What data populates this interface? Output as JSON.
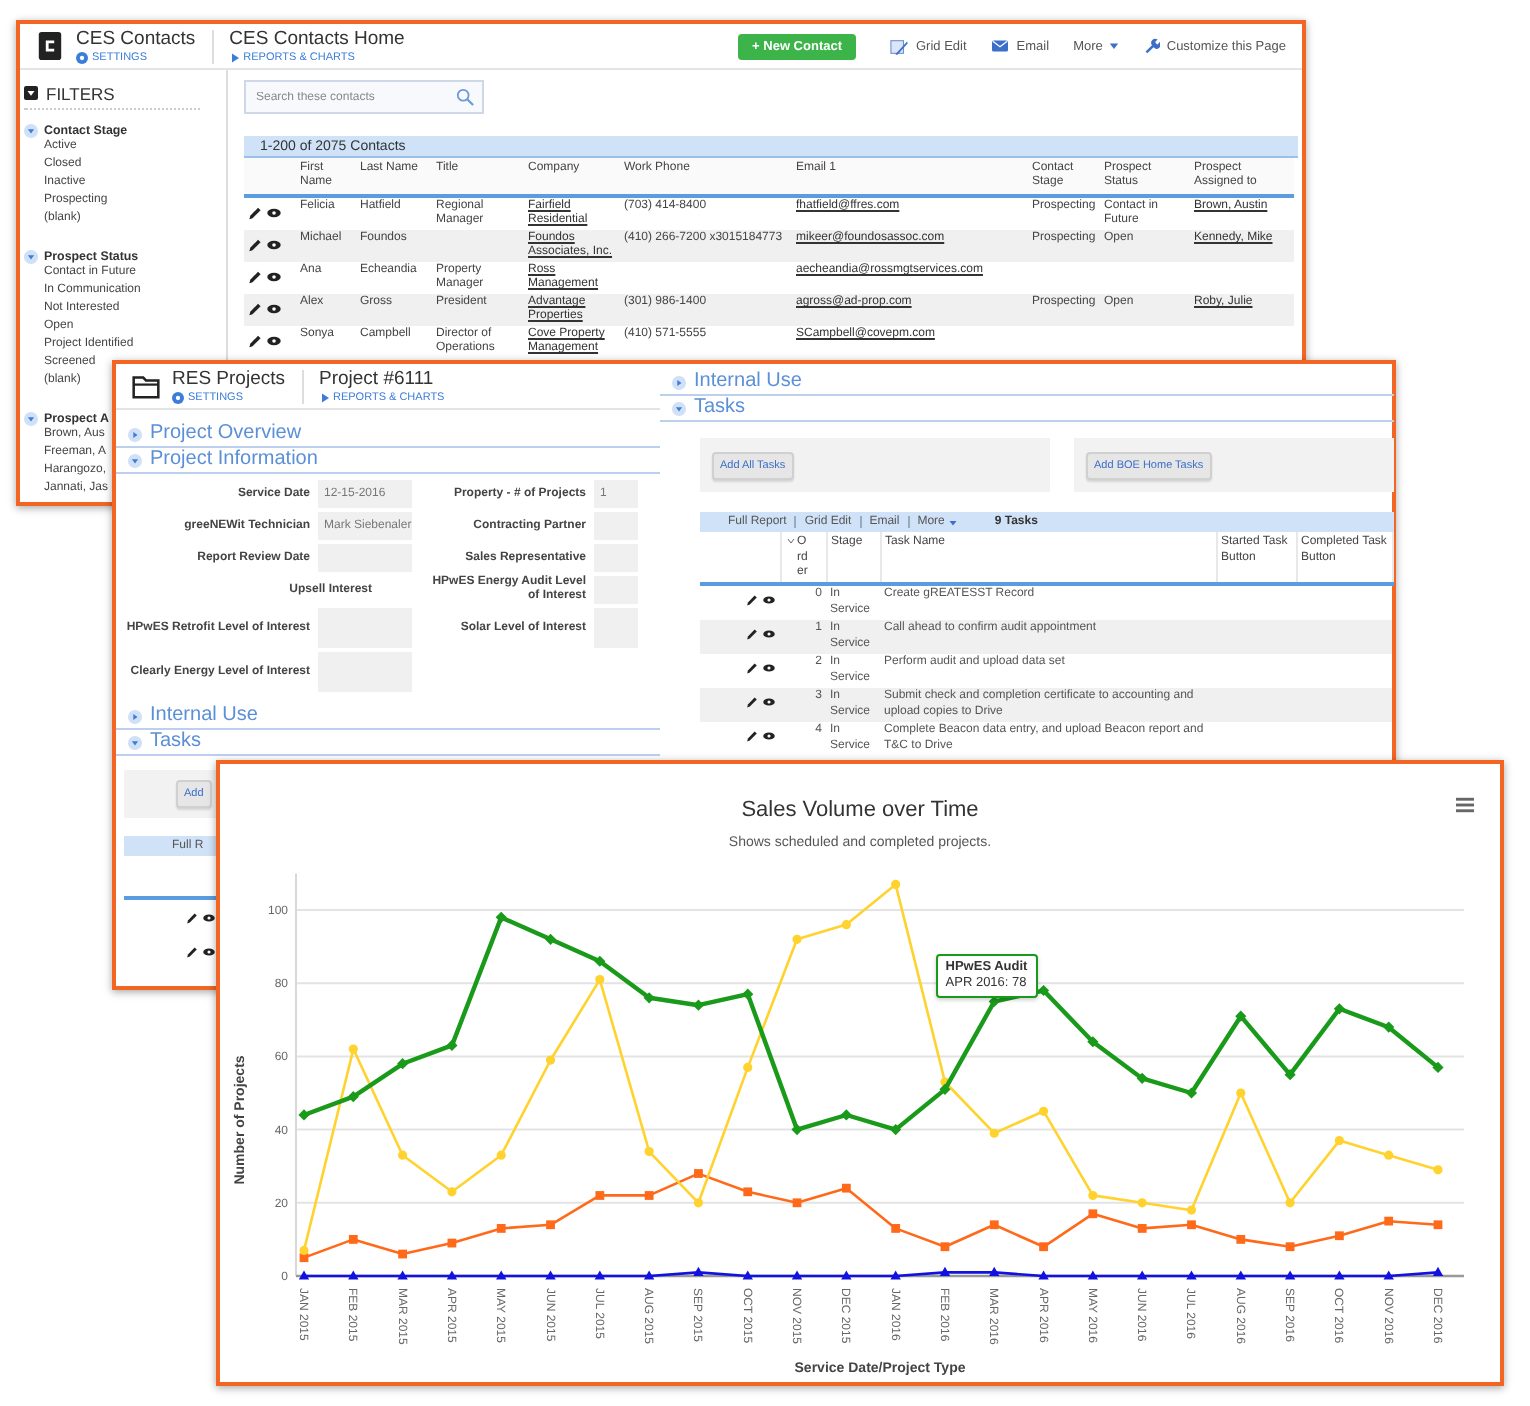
{
  "contacts_window": {
    "app_title": "CES Contacts",
    "settings_link": "SETTINGS",
    "page_title": "CES Contacts Home",
    "reports_link": "REPORTS & CHARTS",
    "new_button": "+ New Contact",
    "toolbar": [
      {
        "kind": "grid",
        "label": "Grid Edit"
      },
      {
        "kind": "email",
        "label": "Email"
      },
      {
        "kind": "more",
        "label": "More"
      },
      {
        "kind": "customize",
        "label": "Customize this Page"
      }
    ],
    "filters": {
      "title": "FILTERS",
      "groups": [
        {
          "title": "Contact Stage",
          "expanded": true,
          "items": [
            "Active",
            "Closed",
            "Inactive",
            "Prospecting",
            "(blank)"
          ]
        },
        {
          "title": "Prospect Status",
          "expanded": true,
          "items": [
            "Contact in Future",
            "In Communication",
            "Not Interested",
            "Open",
            "Project Identified",
            "Screened",
            "(blank)"
          ]
        },
        {
          "title": "Prospect A",
          "expanded": true,
          "items": [
            "Brown, Aus",
            "Freeman, A",
            "Harangozo,",
            "Jannati, Jas"
          ]
        }
      ]
    },
    "search": {
      "placeholder": "Search these contacts"
    },
    "table": {
      "count": "1-200 of 2075 Contacts",
      "columns": [
        {
          "label": "First Name",
          "kind": "text"
        },
        {
          "label": "Last Name",
          "kind": "text"
        },
        {
          "label": "Title",
          "kind": "text"
        },
        {
          "label": "Company",
          "kind": "link"
        },
        {
          "label": "Work Phone",
          "kind": "text"
        },
        {
          "label": "Email 1",
          "kind": "link"
        },
        {
          "label": "Contact Stage",
          "kind": "text"
        },
        {
          "label": "Prospect Status",
          "kind": "text"
        },
        {
          "label": "Prospect Assigned to",
          "kind": "link"
        }
      ],
      "rows": [
        [
          "Felicia",
          "Hatfield",
          "Regional Manager",
          "Fairfield Residential",
          "(703) 414-8400",
          "fhatfield@ffres.com",
          "Prospecting",
          "Contact in Future",
          "Brown, Austin"
        ],
        [
          "Michael",
          "Foundos",
          null,
          "Foundos Associates, Inc.",
          "(410) 266-7200 x3015184773",
          "mikeer@foundosassoc.com",
          "Prospecting",
          "Open",
          "Kennedy, Mike"
        ],
        [
          "Ana",
          "Echeandia",
          "Property Manager",
          "Ross Management",
          null,
          "aecheandia@rossmgtservices.com",
          null,
          null,
          null
        ],
        [
          "Alex",
          "Gross",
          "President",
          "Advantage Properties",
          "(301) 986-1400",
          "agross@ad-prop.com",
          "Prospecting",
          "Open",
          "Roby, Julie"
        ],
        [
          "Sonya",
          "Campbell",
          "Director of Operations",
          "Cove Property Management",
          "(410) 571-5555",
          "SCampbell@covepm.com",
          null,
          null,
          null
        ]
      ]
    }
  },
  "projects_window": {
    "app_title": "RES Projects",
    "settings_link": "SETTINGS",
    "page_title": "Project #6111",
    "reports_link": "REPORTS & CHARTS",
    "sections": [
      {
        "title": "Project Overview",
        "expanded": false
      },
      {
        "title": "Project Information",
        "expanded": true
      }
    ],
    "form": [
      {
        "kind": "field",
        "label": "Service Date",
        "value": "12-15-2016"
      },
      {
        "kind": "field",
        "label": "Property - # of Projects",
        "value": "1"
      },
      {
        "kind": "field",
        "label": "greeNEWit Technician",
        "value": "Mark Siebenaler"
      },
      {
        "kind": "field",
        "label": "Contracting Partner"
      },
      {
        "kind": "field",
        "label": "Report Review Date"
      },
      {
        "kind": "field",
        "label": "Sales Representative"
      },
      {
        "kind": "heading",
        "label": "Upsell Interest"
      },
      {
        "kind": "field",
        "label": "HPwES Energy Audit Level of Interest"
      },
      {
        "kind": "field",
        "label": "HPwES Retrofit Level of Interest"
      },
      {
        "kind": "field",
        "label": "Solar Level of Interest"
      },
      {
        "kind": "field",
        "label": "Clearly Energy Level of Interest"
      }
    ],
    "lower_sections": [
      {
        "title": "Internal Use",
        "expanded": false
      },
      {
        "title": "Tasks",
        "expanded": true
      }
    ],
    "tasks_preview": {
      "buttons": [
        "Add"
      ],
      "toolbar": [
        "Full R"
      ],
      "rows": [
        {
          "kind": "actions"
        },
        {
          "kind": "actions"
        }
      ]
    },
    "tasks_panel": {
      "sections": [
        {
          "title": "Internal Use",
          "expanded": false
        },
        {
          "title": "Tasks",
          "expanded": true
        }
      ],
      "buttons": [
        "Add All Tasks",
        "Add BOE Home Tasks"
      ],
      "toolbar": [
        "Full Report",
        "Grid Edit",
        "Email",
        "More"
      ],
      "count": "9 Tasks",
      "columns": [
        {
          "label": "Order",
          "sorted": true
        },
        {
          "label": "Stage",
          "sorted": false
        },
        {
          "label": "Task Name",
          "sorted": false
        },
        {
          "label": "Started Task Button",
          "sorted": false
        },
        {
          "label": "Completed Task Button",
          "sorted": false
        }
      ],
      "rows": [
        {
          "order": "0",
          "stage": "In Service",
          "task": "Create gREATESST Record"
        },
        {
          "order": "1",
          "stage": "In Service",
          "task": "Call ahead to confirm audit appointment"
        },
        {
          "order": "2",
          "stage": "In Service",
          "task": "Perform audit and upload data set"
        },
        {
          "order": "3",
          "stage": "In Service",
          "task": "Submit check and completion certificate to accounting and upload copies to Drive"
        },
        {
          "order": "4",
          "stage": "In Service",
          "task": "Complete Beacon data entry, and upload Beacon report and T&C to Drive"
        }
      ]
    }
  },
  "chart_window": {
    "subtitle": "Shows scheduled and completed projects.",
    "chart_data": {
      "type": "line",
      "title": "Sales Volume over Time",
      "xlabel": "Service Date/Project Type",
      "ylabel": "Number of Projects",
      "categories": [
        "JAN 2015",
        "FEB 2015",
        "MAR 2015",
        "APR 2015",
        "MAY 2015",
        "JUN 2015",
        "JUL 2015",
        "AUG 2015",
        "SEP 2015",
        "OCT 2015",
        "NOV 2015",
        "DEC 2015",
        "JAN 2016",
        "FEB 2016",
        "MAR 2016",
        "APR 2016",
        "MAY 2016",
        "JUN 2016",
        "JUL 2016",
        "AUG 2016",
        "SEP 2016",
        "OCT 2016",
        "NOV 2016",
        "DEC 2016"
      ],
      "ylim": [
        0,
        110
      ],
      "yticks": [
        0,
        20,
        40,
        60,
        80,
        100
      ],
      "grid": true,
      "series": [
        {
          "name": "HPwES Audit",
          "color": "#1a9a1a",
          "marker": "diamond",
          "values": [
            44,
            49,
            58,
            63,
            98,
            92,
            86,
            76,
            74,
            77,
            40,
            44,
            40,
            51,
            75,
            78,
            64,
            54,
            50,
            71,
            55,
            73,
            68,
            57
          ]
        },
        {
          "color": "#ffd22e",
          "marker": "circle",
          "values": [
            7,
            62,
            33,
            23,
            33,
            59,
            81,
            34,
            20,
            57,
            92,
            96,
            107,
            53,
            39,
            45,
            22,
            20,
            18,
            50,
            20,
            37,
            33,
            29
          ]
        },
        {
          "color": "#ff6a1a",
          "marker": "square",
          "values": [
            5,
            10,
            6,
            9,
            13,
            14,
            22,
            22,
            28,
            23,
            20,
            24,
            13,
            8,
            14,
            8,
            17,
            13,
            14,
            10,
            8,
            11,
            15,
            14
          ]
        },
        {
          "color": "#1212e0",
          "marker": "triangle",
          "values": [
            0,
            0,
            0,
            0,
            0,
            0,
            0,
            0,
            1,
            0,
            0,
            0,
            0,
            1,
            1,
            0,
            0,
            0,
            0,
            0,
            0,
            0,
            0,
            1
          ]
        }
      ],
      "annotations": [
        {
          "x": "APR 2016",
          "text": "APR 2016: 78"
        }
      ]
    }
  }
}
